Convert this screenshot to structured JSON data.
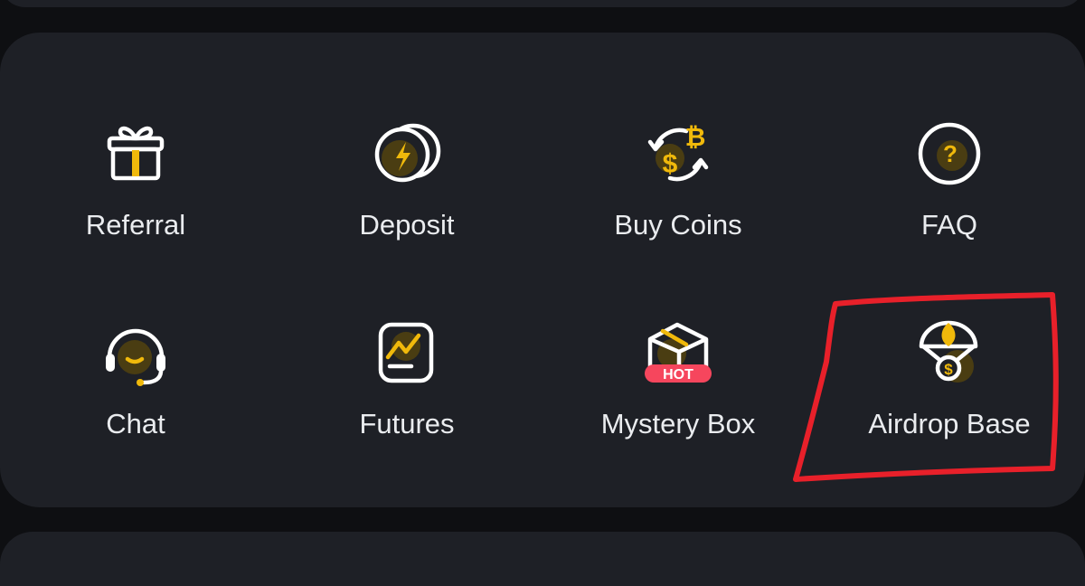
{
  "colors": {
    "page_bg": "#0e0f12",
    "card_bg": "#1e2026",
    "label_text": "#eaecef",
    "icon_outline": "#ffffff",
    "icon_accent": "#f0b90b",
    "hot_badge": "#f6465d",
    "highlight_stroke": "#e8202a"
  },
  "menu": {
    "items": [
      {
        "label": "Referral",
        "icon": "gift-icon"
      },
      {
        "label": "Deposit",
        "icon": "coins-lightning-icon"
      },
      {
        "label": "Buy Coins",
        "icon": "currency-exchange-icon"
      },
      {
        "label": "FAQ",
        "icon": "question-circle-icon"
      },
      {
        "label": "Chat",
        "icon": "headset-icon"
      },
      {
        "label": "Futures",
        "icon": "futures-chart-icon"
      },
      {
        "label": "Mystery Box",
        "icon": "mystery-box-icon",
        "badge": "HOT"
      },
      {
        "label": "Airdrop Base",
        "icon": "parachute-icon"
      }
    ]
  }
}
